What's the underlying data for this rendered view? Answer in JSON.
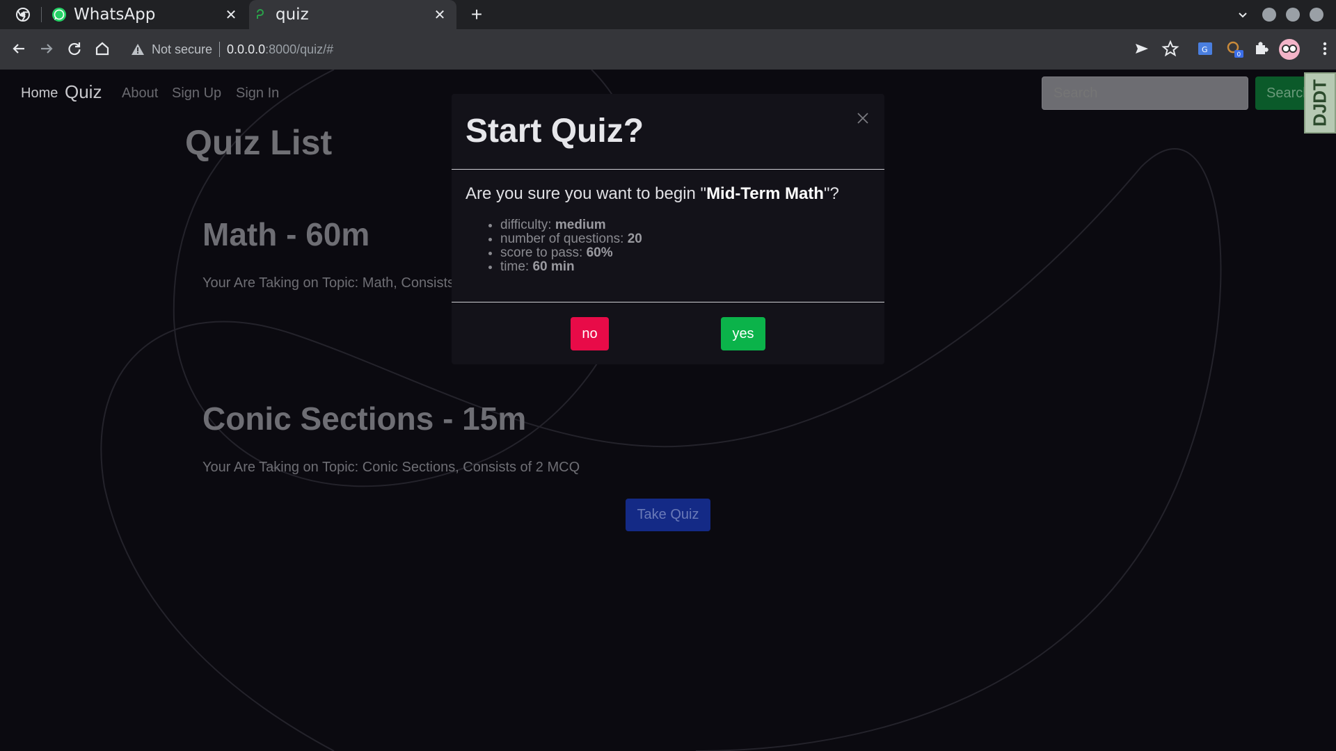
{
  "browser": {
    "tabs": [
      {
        "title": "WhatsApp",
        "icon": "whatsapp-icon",
        "active": false
      },
      {
        "title": "quiz",
        "icon": "django-favicon-icon",
        "active": true
      }
    ],
    "security_label": "Not secure",
    "url_host": "0.0.0.0",
    "url_path": ":8000/quiz/#",
    "extension_badge": "0"
  },
  "navbar": {
    "home": "Home",
    "brand": "Quiz",
    "links": [
      "About",
      "Sign Up",
      "Sign In"
    ],
    "search_placeholder": "Search",
    "search_button": "Search",
    "debug_toolbar": "DJDT"
  },
  "main": {
    "title": "Quiz List",
    "quizzes": [
      {
        "title": "Math - 60m",
        "description": "Your Are Taking on Topic: Math, Consists"
      },
      {
        "title": "Conic Sections - 15m",
        "description": "Your Are Taking on Topic: Conic Sections, Consists of 2 MCQ",
        "button": "Take Quiz"
      }
    ]
  },
  "modal": {
    "title": "Start Quiz?",
    "question_prefix": "Are you sure you want to begin \"",
    "quiz_name": "Mid-Term Math",
    "question_suffix": "\"?",
    "details": [
      {
        "label": "difficulty: ",
        "value": "medium"
      },
      {
        "label": "number of questions: ",
        "value": "20"
      },
      {
        "label": "score to pass: ",
        "value": "60%"
      },
      {
        "label": "time: ",
        "value": "60 min"
      }
    ],
    "no_label": "no",
    "yes_label": "yes"
  },
  "colors": {
    "no_button": "#e80b48",
    "yes_button": "#0bb34a",
    "take_quiz_button": "#142a86"
  }
}
